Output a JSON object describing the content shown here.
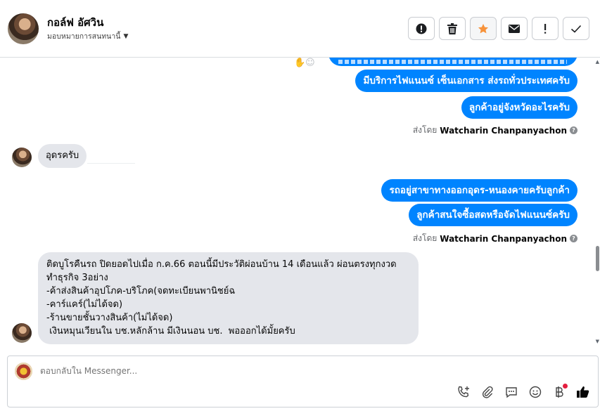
{
  "header": {
    "name": "กอล์ฟ อัศวิน",
    "assign_label": "มอบหมายการสนทนานี้"
  },
  "actions": [
    {
      "id": "mark-spam",
      "icon": "alert-circle-icon"
    },
    {
      "id": "delete",
      "icon": "trash-icon"
    },
    {
      "id": "star",
      "icon": "star-icon",
      "color": "#f7923a"
    },
    {
      "id": "mark-unread",
      "icon": "envelope-icon"
    },
    {
      "id": "follow-up",
      "icon": "exclamation-icon"
    },
    {
      "id": "mark-done",
      "icon": "checkmark-icon"
    }
  ],
  "messages": {
    "out1": "มีบริการไฟแนนซ์ เซ็นเอกสาร ส่งรถทั่วประเทศครับ",
    "out2": "ลูกค้าอยู่จังหวัดอะไรครับ",
    "in1": "อุดรครับ",
    "out3": "รถอยู่สาขาทางออกอุดร-หนองคายครับลูกค้า",
    "out4": "ลูกค้าสนใจซื้อสดหรือจัดไฟแนนซ์ครับ",
    "in2_lines": [
      "ติดบูโรคืนรถ ปิดยอดไปเมื่อ ก.ค.66  ตอนนี้มีประวัติผ่อนบ้าน 14 เดือนแล้ว ผ่อนตรงทุกงวด",
      "ทำธุรกิจ 3อย่าง",
      "-ค้าส่งสินค้าอุปโภค-บริโภค(จดทะเบียนพานิชย์ฉ",
      "-คาร์แคร์(ไม่ได้จด)",
      "-ร้านขายชั้นวางสินค้า(ไม่ได้จด)",
      " เงินหมุนเวียนใน บช.หลักล้าน มีเงินนอน บช.  พอออกได้มั้ยครับ"
    ]
  },
  "sent_by": {
    "prefix": "ส่งโดย",
    "agent": "Watcharin Chanpanyachon"
  },
  "composer": {
    "placeholder": "ตอบกลับใน Messenger..."
  },
  "colors": {
    "outgoing_bubble": "#0084ff",
    "incoming_bubble": "#e4e6eb",
    "like": "#050505"
  }
}
